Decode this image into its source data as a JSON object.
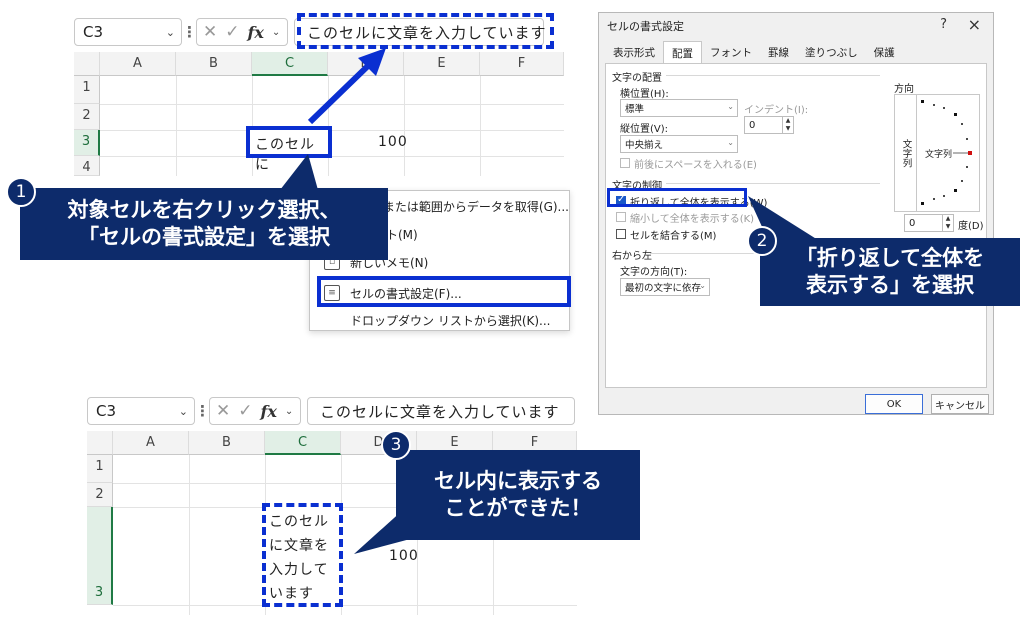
{
  "top_excel": {
    "name_box": "C3",
    "formula": "このセルに文章を入力しています",
    "columns": [
      "A",
      "B",
      "C",
      "D",
      "E",
      "F"
    ],
    "rows": [
      "1",
      "2",
      "3",
      "4"
    ],
    "cell_c3": "このセルに",
    "cell_d3": "100"
  },
  "context_menu": {
    "items": [
      "テーブルまたは範囲からデータを取得(G)...",
      "コメント(M)",
      "新しいメモ(N)",
      "セルの書式設定(F)...",
      "ドロップダウン リストから選択(K)..."
    ]
  },
  "callouts": {
    "c1": {
      "num": "1",
      "line1": "対象セルを右クリック選択、",
      "line2": "「セルの書式設定」を選択"
    },
    "c2": {
      "num": "2",
      "line1": "「折り返して全体を",
      "line2": "表示する」を選択"
    },
    "c3": {
      "num": "3",
      "line1": "セル内に表示する",
      "line2": "ことができた！"
    }
  },
  "dialog": {
    "title": "セルの書式設定",
    "help": "?",
    "close": "×",
    "tabs": [
      "表示形式",
      "配置",
      "フォント",
      "罫線",
      "塗りつぶし",
      "保護"
    ],
    "active_tab": "配置",
    "section_alignment": "文字の配置",
    "horizontal_label": "横位置(H):",
    "horizontal_value": "標準",
    "indent_label": "インデント(I):",
    "indent_value": "0",
    "vertical_label": "縦位置(V):",
    "vertical_value": "中央揃え",
    "justify_distributed": "前後にスペースを入れる(E)",
    "section_control": "文字の制御",
    "wrap_text": "折り返して全体を表示する(W)",
    "shrink_to_fit": "縮小して全体を表示する(K)",
    "merge_cells": "セルを結合する(M)",
    "section_rtl": "右から左",
    "direction_label": "文字の方向(T):",
    "direction_value": "最初の文字に依存",
    "orientation_label": "方向",
    "orientation_vertical": "文字列",
    "orientation_text": "文字列",
    "degree_value": "0",
    "degree_label": "度(D)",
    "ok": "OK",
    "cancel": "キャンセル"
  },
  "bottom_excel": {
    "name_box": "C3",
    "formula": "このセルに文章を入力しています",
    "columns": [
      "A",
      "B",
      "C",
      "D",
      "E",
      "F"
    ],
    "rows": [
      "1",
      "2",
      "3"
    ],
    "cell_c3_lines": [
      "このセル",
      "に文章を",
      "入力して",
      "います"
    ],
    "cell_d3": "100"
  }
}
